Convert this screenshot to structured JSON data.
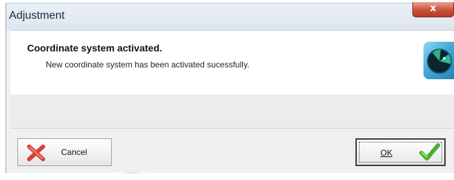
{
  "window": {
    "title": "Adjustment",
    "close_label": "x"
  },
  "message": {
    "heading": "Coordinate system activated.",
    "body": "New coordinate system has been activated sucessfully.",
    "icon": "globe-icon"
  },
  "buttons": {
    "cancel": {
      "label": "Cancel",
      "icon": "x-icon",
      "icon_color": "#d9413a"
    },
    "ok": {
      "label": "OK",
      "icon": "check-icon",
      "icon_color": "#4caf2a"
    }
  },
  "colors": {
    "close_button": "#c8503a",
    "icon_blue": "#3fa6d6"
  }
}
